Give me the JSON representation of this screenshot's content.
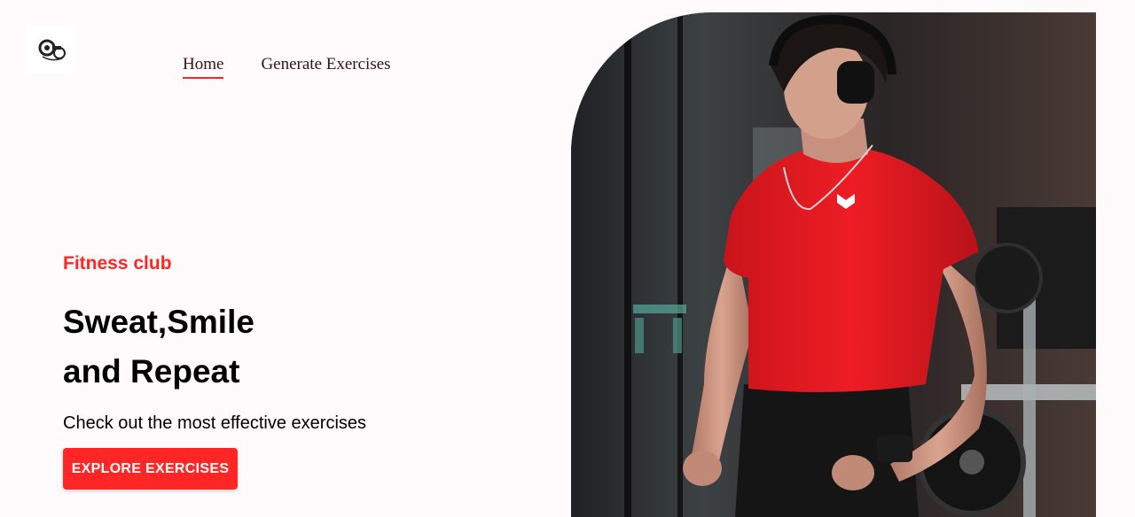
{
  "logo": {
    "icon": "gym-logo-icon"
  },
  "nav": {
    "items": [
      {
        "label": "Home",
        "active": true
      },
      {
        "label": "Generate Exercises",
        "active": false
      }
    ]
  },
  "hero": {
    "eyebrow": "Fitness club",
    "headline_line1": "Sweat,Smile",
    "headline_line2": "and Repeat",
    "subtext": "Check out the most effective exercises",
    "cta_label": "EXPLORE EXERCISES",
    "image": {
      "icon": "athlete-photo"
    }
  },
  "colors": {
    "accent": "#ff2625",
    "background": "#fffafb",
    "nav_text": "#3a1212"
  }
}
